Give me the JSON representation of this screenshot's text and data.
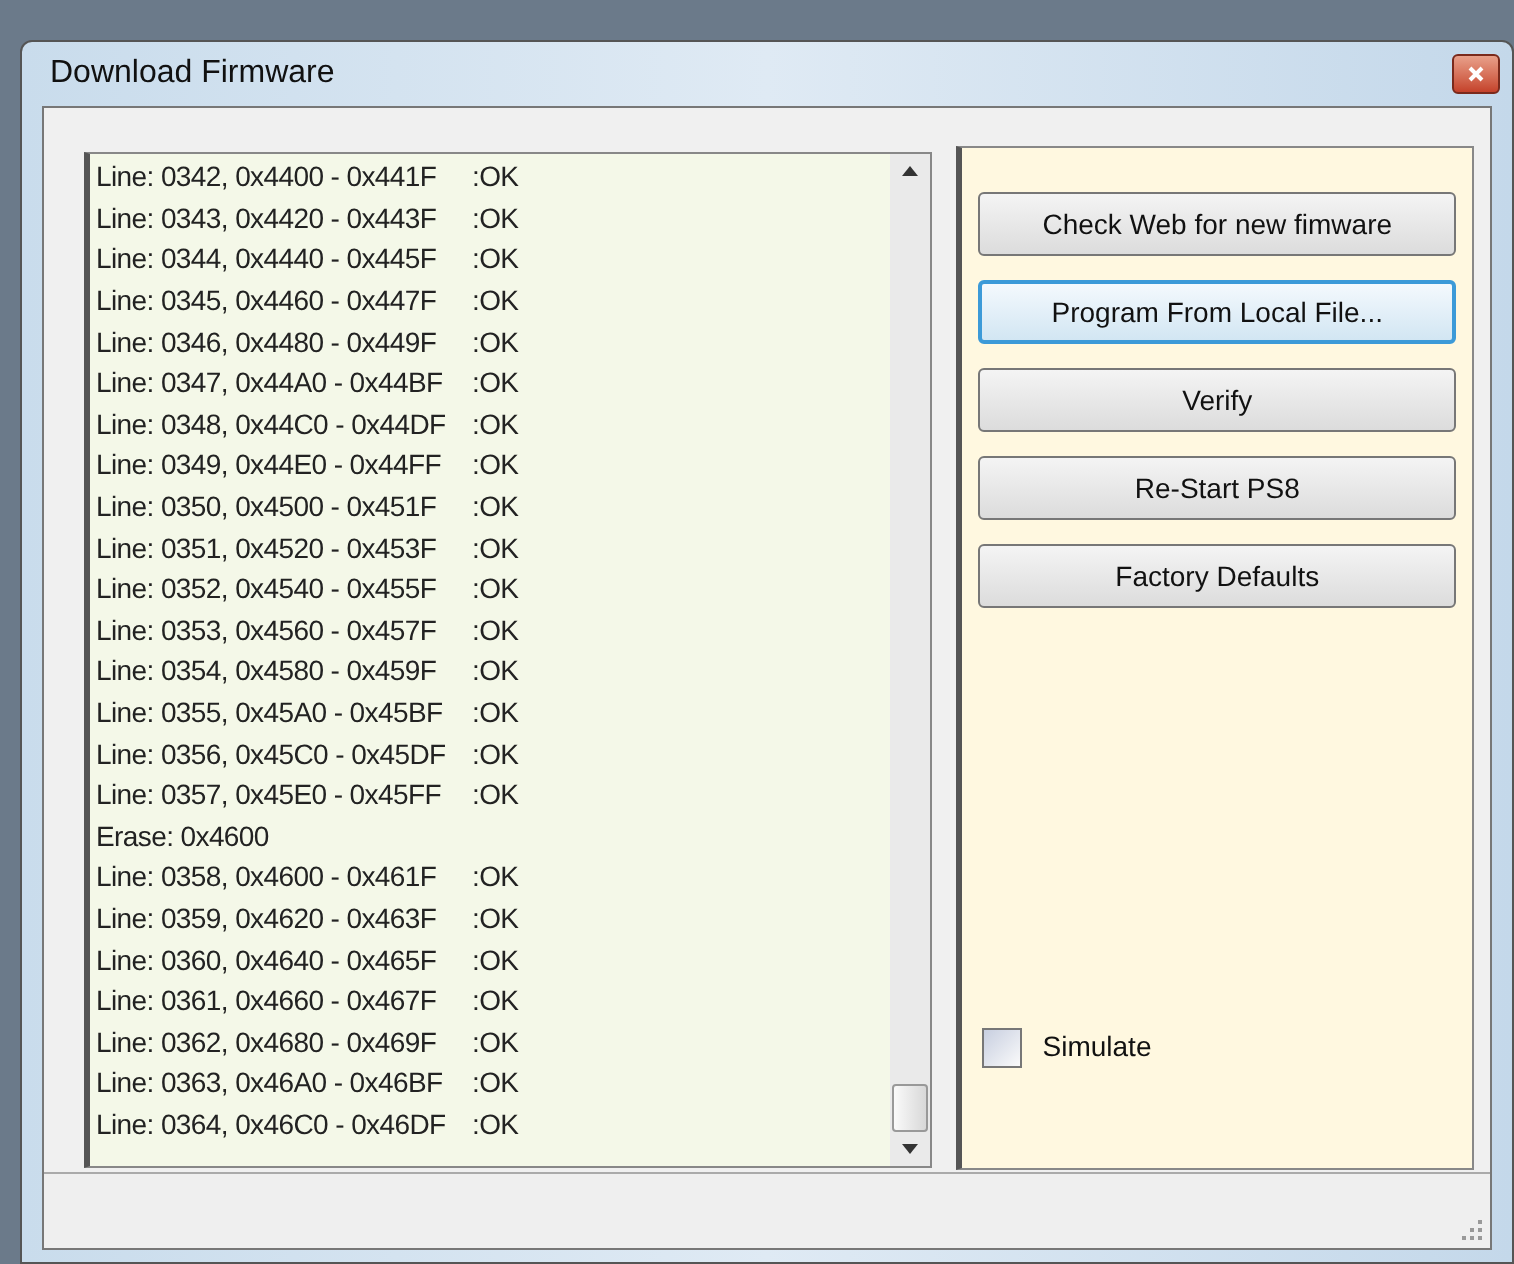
{
  "window": {
    "title": "Download Firmware"
  },
  "log": [
    {
      "text": "Line: 0342, 0x4400 - 0x441F",
      "status": ":OK"
    },
    {
      "text": "Line: 0343, 0x4420 - 0x443F",
      "status": ":OK"
    },
    {
      "text": "Line: 0344, 0x4440 - 0x445F",
      "status": ":OK"
    },
    {
      "text": "Line: 0345, 0x4460 - 0x447F",
      "status": ":OK"
    },
    {
      "text": "Line: 0346, 0x4480 - 0x449F",
      "status": ":OK"
    },
    {
      "text": "Line: 0347, 0x44A0 - 0x44BF",
      "status": ":OK"
    },
    {
      "text": "Line: 0348, 0x44C0 - 0x44DF",
      "status": ":OK"
    },
    {
      "text": "Line: 0349, 0x44E0 - 0x44FF",
      "status": ":OK"
    },
    {
      "text": "Line: 0350, 0x4500 - 0x451F",
      "status": ":OK"
    },
    {
      "text": "Line: 0351, 0x4520 - 0x453F",
      "status": ":OK"
    },
    {
      "text": "Line: 0352, 0x4540 - 0x455F",
      "status": ":OK"
    },
    {
      "text": "Line: 0353, 0x4560 - 0x457F",
      "status": ":OK"
    },
    {
      "text": "Line: 0354, 0x4580 - 0x459F",
      "status": ":OK"
    },
    {
      "text": "Line: 0355, 0x45A0 - 0x45BF",
      "status": ":OK"
    },
    {
      "text": "Line: 0356, 0x45C0 - 0x45DF",
      "status": ":OK"
    },
    {
      "text": "Line: 0357, 0x45E0 - 0x45FF",
      "status": ":OK"
    },
    {
      "text": "Erase: 0x4600"
    },
    {
      "text": "Line: 0358, 0x4600 - 0x461F",
      "status": ":OK"
    },
    {
      "text": "Line: 0359, 0x4620 - 0x463F",
      "status": ":OK"
    },
    {
      "text": "Line: 0360, 0x4640 - 0x465F",
      "status": ":OK"
    },
    {
      "text": "Line: 0361, 0x4660 - 0x467F",
      "status": ":OK"
    },
    {
      "text": "Line: 0362, 0x4680 - 0x469F",
      "status": ":OK"
    },
    {
      "text": "Line: 0363, 0x46A0 - 0x46BF",
      "status": ":OK"
    },
    {
      "text": "Line: 0364, 0x46C0 - 0x46DF",
      "status": ":OK"
    }
  ],
  "buttons": [
    {
      "label": "Check Web for new fimware",
      "focused": false
    },
    {
      "label": "Program From Local File...",
      "focused": true
    },
    {
      "label": "Verify",
      "focused": false
    },
    {
      "label": "Re-Start PS8",
      "focused": false
    },
    {
      "label": "Factory Defaults",
      "focused": false
    }
  ],
  "simulate": {
    "label": "Simulate",
    "checked": false
  }
}
